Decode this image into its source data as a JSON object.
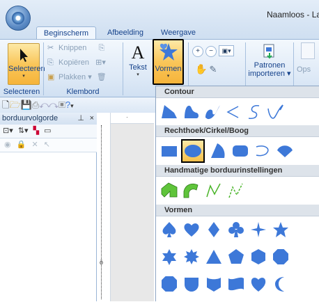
{
  "window": {
    "title": "Naamloos - Lay"
  },
  "tabs": [
    {
      "label": "Beginscherm",
      "active": true
    },
    {
      "label": "Afbeelding",
      "active": false
    },
    {
      "label": "Weergave",
      "active": false
    }
  ],
  "ribbon": {
    "select_label": "Selecteren",
    "clipboard": {
      "cut": "Knippen",
      "copy": "Kopiëren",
      "paste": "Plakken"
    },
    "text_label": "Tekst",
    "shapes_label": "Vormen",
    "import_label_line1": "Patronen",
    "import_label_line2": "importeren",
    "partial_label": "Ops",
    "group_select": "Selecteren",
    "group_clipboard": "Klembord"
  },
  "panel": {
    "title": "borduurvolgorde",
    "pin": "p",
    "close": "×"
  },
  "dropdown": {
    "sections": [
      {
        "title": "Contour"
      },
      {
        "title": "Rechthoek/Cirkel/Boog"
      },
      {
        "title": "Handmatige borduurinstellingen"
      },
      {
        "title": "Vormen"
      }
    ]
  },
  "colors": {
    "accent": "#3d78d8",
    "highlight": "#f9c65a"
  }
}
